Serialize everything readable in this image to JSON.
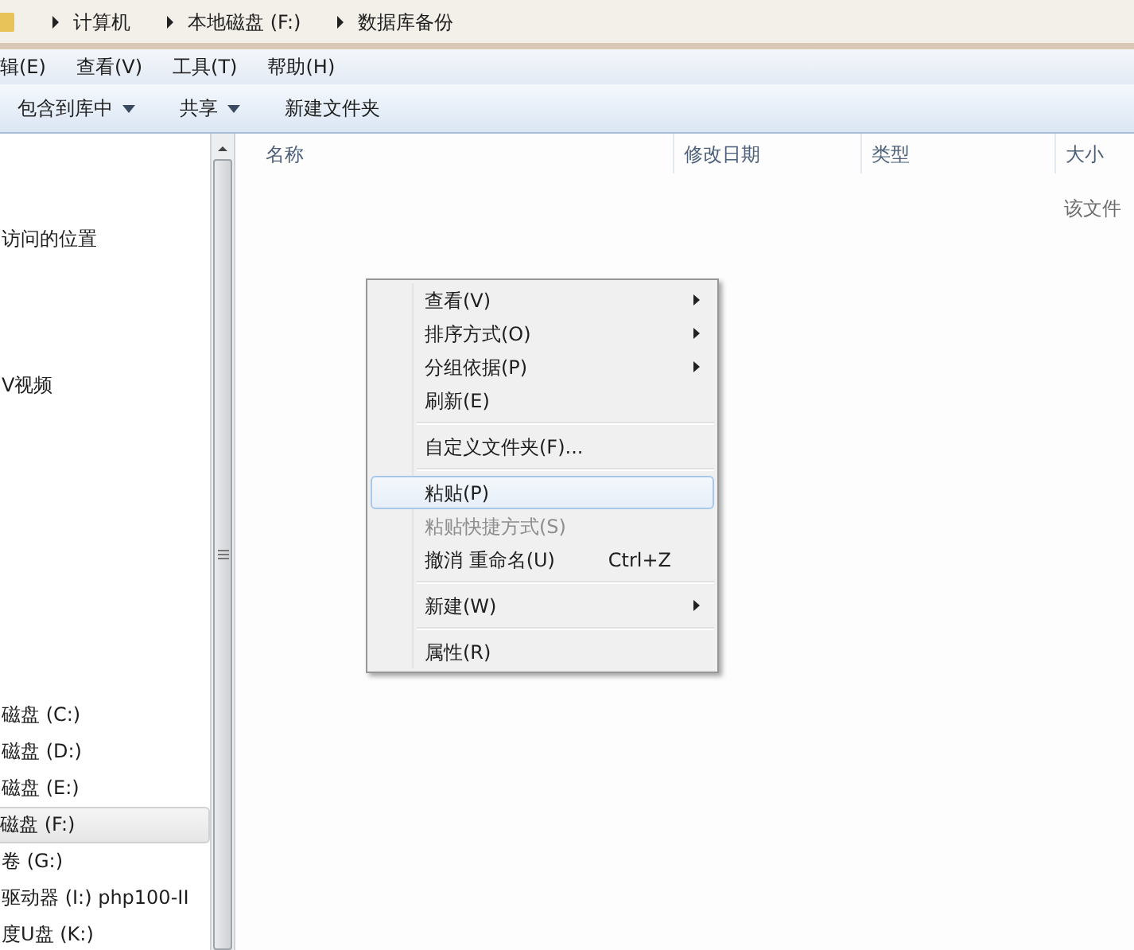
{
  "breadcrumb": [
    "计算机",
    "本地磁盘 (F:)",
    "数据库备份"
  ],
  "menu_bar": [
    "辑(E)",
    "查看(V)",
    "工具(T)",
    "帮助(H)"
  ],
  "toolbar": [
    {
      "label": "包含到库中",
      "dropdown": true
    },
    {
      "label": "共享",
      "dropdown": true
    },
    {
      "label": "新建文件夹",
      "dropdown": false
    }
  ],
  "sidebar": {
    "items": [
      {
        "label": "访问的位置",
        "selected": false
      },
      {
        "label": "V视频",
        "selected": false
      },
      {
        "label": "磁盘 (C:)",
        "selected": false
      },
      {
        "label": "磁盘 (D:)",
        "selected": false
      },
      {
        "label": "磁盘 (E:)",
        "selected": false
      },
      {
        "label": "磁盘 (F:)",
        "selected": true
      },
      {
        "label": "卷 (G:)",
        "selected": false
      },
      {
        "label": "驱动器 (I:) php100-II",
        "selected": false
      },
      {
        "label": "度U盘 (K:)",
        "selected": false
      }
    ]
  },
  "columns": [
    "名称",
    "修改日期",
    "类型",
    "大小"
  ],
  "empty_message": "该文件",
  "context_menu": [
    {
      "kind": "item",
      "label": "查看(V)",
      "submenu": true,
      "disabled": false,
      "selected": false
    },
    {
      "kind": "item",
      "label": "排序方式(O)",
      "submenu": true,
      "disabled": false,
      "selected": false
    },
    {
      "kind": "item",
      "label": "分组依据(P)",
      "submenu": true,
      "disabled": false,
      "selected": false
    },
    {
      "kind": "item",
      "label": "刷新(E)",
      "submenu": false,
      "disabled": false,
      "selected": false
    },
    {
      "kind": "separator"
    },
    {
      "kind": "item",
      "label": "自定义文件夹(F)...",
      "submenu": false,
      "disabled": false,
      "selected": false
    },
    {
      "kind": "separator"
    },
    {
      "kind": "item",
      "label": "粘贴(P)",
      "submenu": false,
      "disabled": false,
      "selected": true
    },
    {
      "kind": "item",
      "label": "粘贴快捷方式(S)",
      "submenu": false,
      "disabled": true,
      "selected": false
    },
    {
      "kind": "item",
      "label": "撤消 重命名(U)",
      "shortcut": "Ctrl+Z",
      "submenu": false,
      "disabled": false,
      "selected": false
    },
    {
      "kind": "separator"
    },
    {
      "kind": "item",
      "label": "新建(W)",
      "submenu": true,
      "disabled": false,
      "selected": false
    },
    {
      "kind": "separator"
    },
    {
      "kind": "item",
      "label": "属性(R)",
      "submenu": false,
      "disabled": false,
      "selected": false
    }
  ]
}
